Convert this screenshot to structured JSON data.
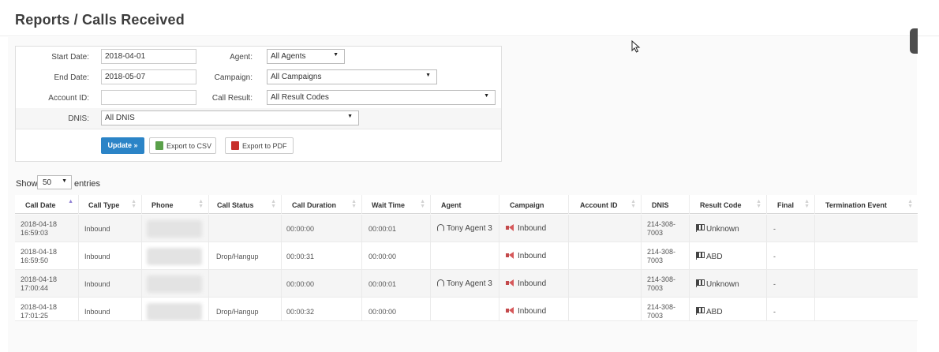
{
  "page": {
    "title": "Reports / Calls Received"
  },
  "filters": {
    "start_date_label": "Start Date:",
    "start_date_value": "2018-04-01",
    "end_date_label": "End Date:",
    "end_date_value": "2018-05-07",
    "account_id_label": "Account ID:",
    "account_id_value": "",
    "dnis_label": "DNIS:",
    "dnis_value": "All DNIS",
    "agent_label": "Agent:",
    "agent_value": "All Agents",
    "campaign_label": "Campaign:",
    "campaign_value": "All Campaigns",
    "call_result_label": "Call Result:",
    "call_result_value": "All Result Codes"
  },
  "actions": {
    "update": "Update »",
    "export_csv": "Export to CSV",
    "export_pdf": "Export to PDF"
  },
  "length": {
    "show": "Show",
    "value": "50",
    "entries": "entries"
  },
  "table": {
    "headers": [
      "Call Date",
      "Call Type",
      "Phone",
      "Call Status",
      "Call Duration",
      "Wait Time",
      "Agent",
      "Campaign",
      "Account ID",
      "DNIS",
      "Result Code",
      "Final",
      "Termination Event"
    ],
    "rows": [
      {
        "date": "2018-04-18",
        "time": "16:59:03",
        "type": "Inbound",
        "status": "",
        "duration": "00:00:00",
        "wait": "00:00:01",
        "agent": "Tony Agent 3",
        "campaign": "Inbound",
        "account": "",
        "dnis1": "214-308-",
        "dnis2": "7003",
        "result": "Unknown",
        "final": "-",
        "termination": ""
      },
      {
        "date": "2018-04-18",
        "time": "16:59:50",
        "type": "Inbound",
        "status": "Drop/Hangup",
        "duration": "00:00:31",
        "wait": "00:00:00",
        "agent": "",
        "campaign": "Inbound",
        "account": "",
        "dnis1": "214-308-",
        "dnis2": "7003",
        "result": "ABD",
        "final": "-",
        "termination": ""
      },
      {
        "date": "2018-04-18",
        "time": "17:00:44",
        "type": "Inbound",
        "status": "",
        "duration": "00:00:00",
        "wait": "00:00:01",
        "agent": "Tony Agent 3",
        "campaign": "Inbound",
        "account": "",
        "dnis1": "214-308-",
        "dnis2": "7003",
        "result": "Unknown",
        "final": "-",
        "termination": ""
      },
      {
        "date": "2018-04-18",
        "time": "17:01:25",
        "type": "Inbound",
        "status": "Drop/Hangup",
        "duration": "00:00:32",
        "wait": "00:00:00",
        "agent": "",
        "campaign": "Inbound",
        "account": "",
        "dnis1": "214-308-",
        "dnis2": "7003",
        "result": "ABD",
        "final": "-",
        "termination": ""
      }
    ]
  },
  "icons": {
    "agent": "headset-icon",
    "campaign": "megaphone-icon",
    "result": "flag-icon",
    "csv": "csv-file-icon",
    "pdf": "pdf-file-icon"
  },
  "colors": {
    "primary": "#2b84c7",
    "sort_active": "#8e7ed3",
    "campaign_icon": "#d6585a"
  }
}
